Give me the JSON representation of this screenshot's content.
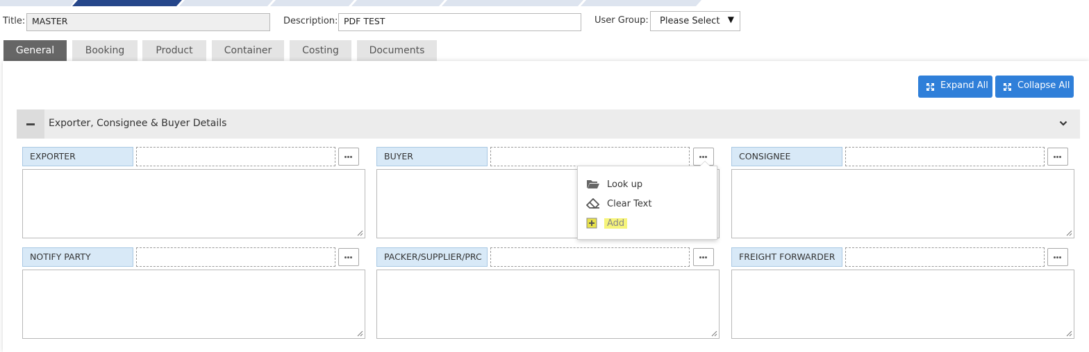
{
  "header": {
    "title_label": "Title:",
    "title_value": "MASTER",
    "description_label": "Description:",
    "description_value": "PDF TEST",
    "user_group_label": "User Group:",
    "user_group_value": "Please Select"
  },
  "tabs": [
    {
      "label": "General",
      "active": true
    },
    {
      "label": "Booking"
    },
    {
      "label": "Product"
    },
    {
      "label": "Container"
    },
    {
      "label": "Costing"
    },
    {
      "label": "Documents"
    }
  ],
  "toolbar": {
    "expand_all": "Expand All",
    "collapse_all": "Collapse All"
  },
  "section": {
    "title": "Exporter, Consignee & Buyer Details"
  },
  "parties": [
    {
      "label": "EXPORTER",
      "code": "",
      "text": ""
    },
    {
      "label": "BUYER",
      "code": "",
      "text": ""
    },
    {
      "label": "CONSIGNEE",
      "code": "",
      "text": ""
    },
    {
      "label": "NOTIFY PARTY",
      "code": "",
      "text": ""
    },
    {
      "label": "PACKER/SUPPLIER/PRC",
      "code": "",
      "text": ""
    },
    {
      "label": "FREIGHT FORWARDER",
      "code": "",
      "text": ""
    }
  ],
  "context_menu": {
    "items": [
      {
        "label": "Look up",
        "icon": "folder-open-icon"
      },
      {
        "label": "Clear Text",
        "icon": "eraser-icon"
      },
      {
        "label": "Add",
        "icon": "plus-square-icon",
        "highlighted": true
      }
    ]
  },
  "colors": {
    "accent_blue": "#2f7fd9",
    "active_tab": "#666666",
    "party_label_bg": "#d8e9f7",
    "highlight": "#f6f47a",
    "step_dark": "#25468a",
    "step_light": "#dde4ef"
  }
}
